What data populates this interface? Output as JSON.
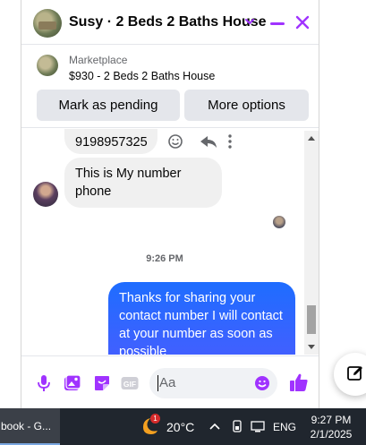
{
  "chat": {
    "title": "Susy · 2 Beds 2 Baths House",
    "accent_color": "#a033ff",
    "listing": {
      "source": "Marketplace",
      "summary": "$930 - 2 Beds 2 Baths House"
    },
    "actions": {
      "mark_pending": "Mark as pending",
      "more_options": "More options"
    },
    "messages": [
      {
        "direction": "incoming",
        "text": "9198957325"
      },
      {
        "direction": "incoming",
        "text": "This is My number phone"
      }
    ],
    "timestamp": "9:26 PM",
    "outgoing": {
      "text": "Thanks for sharing your contact number I will contact at your number as soon as possible",
      "color": "#2f66ff"
    },
    "composer": {
      "placeholder": "Aa"
    }
  },
  "taskbar": {
    "app_label": "book - G...",
    "notification_count": "1",
    "temperature": "20°C",
    "language": "ENG",
    "time": "9:27 PM",
    "date": "2/1/2025"
  }
}
